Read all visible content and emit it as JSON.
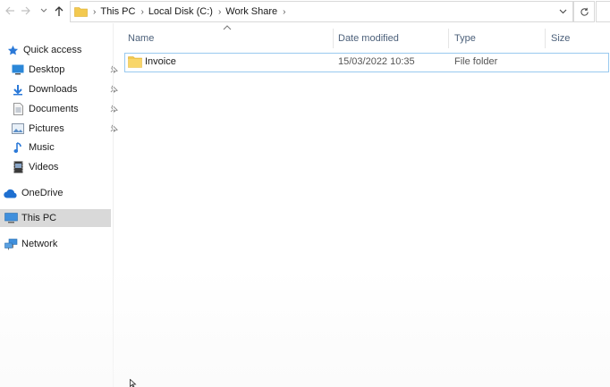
{
  "nav": {
    "back_glyph": "←",
    "forward_glyph": "→",
    "recent_glyph": "⌄",
    "up_glyph": "↑"
  },
  "address": {
    "breadcrumbs": [
      "This PC",
      "Local Disk (C:)",
      "Work Share"
    ],
    "separator": "›"
  },
  "sidebar": {
    "items": [
      {
        "label": "Quick access",
        "icon": "star-icon",
        "pinned": false
      },
      {
        "label": "Desktop",
        "icon": "desktop-icon",
        "pinned": true
      },
      {
        "label": "Downloads",
        "icon": "download-icon",
        "pinned": true
      },
      {
        "label": "Documents",
        "icon": "document-icon",
        "pinned": true
      },
      {
        "label": "Pictures",
        "icon": "pictures-icon",
        "pinned": true
      },
      {
        "label": "Music",
        "icon": "music-icon",
        "pinned": false
      },
      {
        "label": "Videos",
        "icon": "videos-icon",
        "pinned": false
      },
      {
        "label": "OneDrive",
        "icon": "cloud-icon",
        "pinned": false
      },
      {
        "label": "This PC",
        "icon": "computer-icon",
        "pinned": false,
        "selected": true
      },
      {
        "label": "Network",
        "icon": "network-icon",
        "pinned": false
      }
    ]
  },
  "columns": {
    "name": "Name",
    "date_modified": "Date modified",
    "type": "Type",
    "size": "Size"
  },
  "files": [
    {
      "name": "Invoice",
      "date_modified": "15/03/2022 10:35",
      "type": "File folder",
      "size": ""
    }
  ],
  "colors": {
    "accent": "#0078d7",
    "folder": "#f3c94f",
    "selected_border": "#99c9ef",
    "header_text": "#4c607a"
  }
}
